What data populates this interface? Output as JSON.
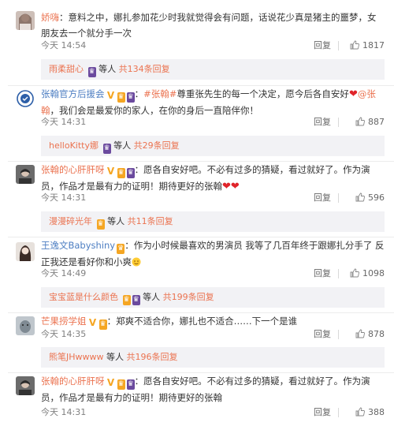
{
  "comments": [
    {
      "name": "娇嗨",
      "text": "：意料之中，娜扎参加花少时我就觉得会有问题，话说花少真是猪主的噩梦，女朋友去一个就分手一次",
      "time": "今天 14:54",
      "reply_label": "回复",
      "likes": "1817",
      "sub": {
        "name": "雨柔甜心",
        "etc": "等人",
        "total": "共134条回复"
      }
    },
    {
      "name": "张翰官方后援会",
      "hashtag": "#张翰#",
      "text": "尊重张先生的每一个决定，愿今后各自安好",
      "mention": "@张翰",
      "text2": "，我们会是最爱你的家人，在你的身后一直陪伴你！",
      "time": "今天 14:31",
      "reply_label": "回复",
      "likes": "887",
      "sub": {
        "name": "helloKitty娜",
        "etc": "等人",
        "total": "共29条回复"
      }
    },
    {
      "name": "张翰的心肝肝呀",
      "text": "：愿各自安好吧。不必有过多的猜疑，看过就好了。作为演员，作品才是最有力的证明！期待更好的张翰",
      "time": "今天 14:31",
      "reply_label": "回复",
      "likes": "596",
      "sub": {
        "name": "漫漫碎光年",
        "etc": "等人",
        "total": "共11条回复"
      }
    },
    {
      "name": "王逸文Babyshiny",
      "text": "：作为小时候最喜欢的男演员 我等了几百年终于跟娜扎分手了 反正我还是看好你和小爽",
      "time": "今天 14:49",
      "reply_label": "回复",
      "likes": "1098",
      "sub": {
        "name": "宝宝蓝是什么颜色",
        "etc": "等人",
        "total": "共199条回复"
      }
    },
    {
      "name": "芒果捞学姐",
      "text": "：郑爽不适合你，娜扎也不适合……下一个是谁",
      "time": "今天 14:35",
      "reply_label": "回复",
      "likes": "878",
      "sub": {
        "name": "熊笔JHwwww",
        "etc": "等人",
        "total": "共196条回复"
      }
    },
    {
      "name": "张翰的心肝肝呀",
      "text": "：愿各自安好吧。不必有过多的猜疑，看过就好了。作为演员，作品才是最有力的证明！期待更好的张翰",
      "time": "今天 14:31",
      "reply_label": "回复",
      "likes": "388"
    }
  ],
  "colors": {
    "name": "#eb7350",
    "name_blue": "#4d7ec2",
    "sub_bg": "#f2f2f5",
    "heart": "#e0242a"
  },
  "icons": {
    "like": "thumbs-up-icon",
    "heart": "heart-icon",
    "vip": "crown-icon",
    "verified": "v-badge-icon"
  }
}
